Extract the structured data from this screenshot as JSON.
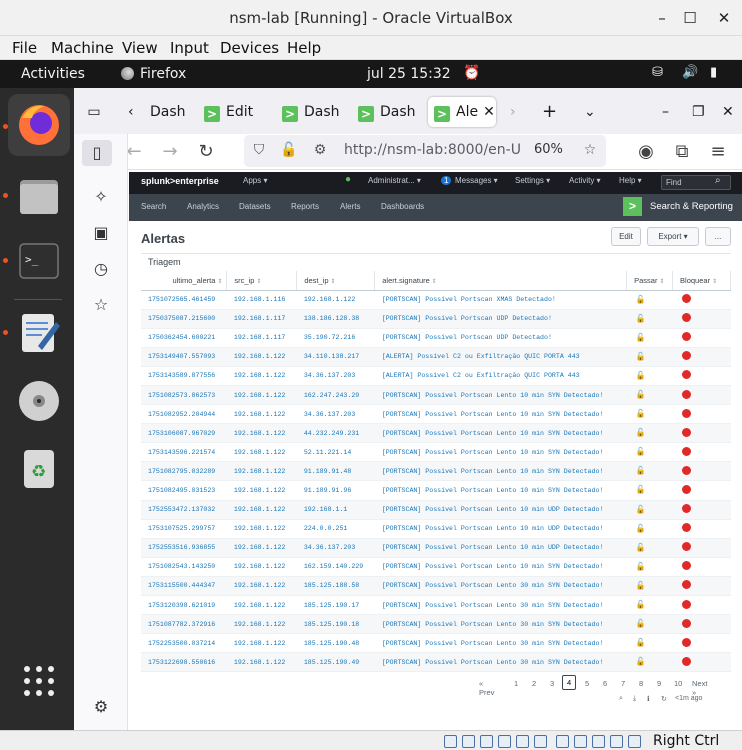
{
  "window": {
    "title": "nsm-lab [Running] - Oracle VirtualBox",
    "min": "–",
    "max": "☐",
    "close": "✕"
  },
  "vbox_menu": [
    "File",
    "Machine",
    "View",
    "Input",
    "Devices",
    "Help"
  ],
  "gnome": {
    "activities": "Activities",
    "app": "Firefox",
    "clock": "jul 25  15:32"
  },
  "tabs": [
    {
      "label": "Dash",
      "icon": ">"
    },
    {
      "label": "Edit",
      "icon": ">"
    },
    {
      "label": "Dash",
      "icon": ">"
    },
    {
      "label": "Dash",
      "icon": ">"
    },
    {
      "label": "Ale",
      "icon": ">"
    }
  ],
  "browser": {
    "url": "http://nsm-lab:8000/en-U",
    "zoom": "60%"
  },
  "splunk": {
    "logo": "splunk>enterprise",
    "top_menu": [
      "Apps ▾",
      "Administrat... ▾",
      "Messages ▾",
      "Settings ▾",
      "Activity ▾",
      "Help ▾"
    ],
    "messages_count": "1",
    "find_placeholder": "Find",
    "app_nav": [
      "Search",
      "Analytics",
      "Datasets",
      "Reports",
      "Alerts",
      "Dashboards"
    ],
    "app_name": "Search & Reporting",
    "page_title": "Alertas",
    "edit_label": "Edit",
    "export_label": "Export ▾",
    "more_label": "...",
    "panel_title": "Triagem",
    "columns": [
      "ultimo_alerta",
      "src_ip",
      "dest_ip",
      "alert.signature",
      "Passar",
      "Bloquear"
    ],
    "rows": [
      [
        "1751072565.461459",
        "192.168.1.116",
        "192.168.1.122",
        "[PORTSCAN] Possível Portscan XMAS Detectado!"
      ],
      [
        "1750375087.215600",
        "192.168.1.117",
        "138.186.128.38",
        "[PORTSCAN] Possível Portscan UDP Detectado!"
      ],
      [
        "1750362454.600221",
        "192.168.1.117",
        "35.190.72.216",
        "[PORTSCAN] Possível Portscan UDP Detectado!"
      ],
      [
        "1753149407.557093",
        "192.168.1.122",
        "34.110.138.217",
        "[ALERTA] Possível C2 ou Exfiltração QUIC PORTA 443"
      ],
      [
        "1753143589.877556",
        "192.168.1.122",
        "34.36.137.203",
        "[ALERTA] Possível C2 ou Exfiltração QUIC PORTA 443"
      ],
      [
        "1751082573.862573",
        "192.168.1.122",
        "162.247.243.29",
        "[PORTSCAN] Possível Portscan Lento 10 min SYN Detectado!"
      ],
      [
        "1751082952.204944",
        "192.168.1.122",
        "34.36.137.203",
        "[PORTSCAN] Possível Portscan Lento 10 min SYN Detectado!"
      ],
      [
        "1753106087.967029",
        "192.168.1.122",
        "44.232.249.231",
        "[PORTSCAN] Possível Portscan Lento 10 min SYN Detectado!"
      ],
      [
        "1753143596.221574",
        "192.168.1.122",
        "52.11.221.14",
        "[PORTSCAN] Possível Portscan Lento 10 min SYN Detectado!"
      ],
      [
        "1751082795.032289",
        "192.168.1.122",
        "91.189.91.48",
        "[PORTSCAN] Possível Portscan Lento 10 min SYN Detectado!"
      ],
      [
        "1751082495.031523",
        "192.168.1.122",
        "91.189.91.96",
        "[PORTSCAN] Possível Portscan Lento 10 min SYN Detectado!"
      ],
      [
        "1752553472.137032",
        "192.168.1.122",
        "192.168.1.1",
        "[PORTSCAN] Possível Portscan Lento 10 min UDP Detectado!"
      ],
      [
        "1753107525.299757",
        "192.168.1.122",
        "224.0.0.251",
        "[PORTSCAN] Possível Portscan Lento 10 min UDP Detectado!"
      ],
      [
        "1752553516.936855",
        "192.168.1.122",
        "34.36.137.203",
        "[PORTSCAN] Possível Portscan Lento 10 min UDP Detectado!"
      ],
      [
        "1751082543.143250",
        "192.168.1.122",
        "162.159.140.229",
        "[PORTSCAN] Possível Portscan Lento 10 min SYN Detectado!"
      ],
      [
        "1753115500.444347",
        "192.168.1.122",
        "185.125.188.58",
        "[PORTSCAN] Possível Portscan Lento 30 min SYN Detectado!"
      ],
      [
        "1753120398.621019",
        "192.168.1.122",
        "185.125.190.17",
        "[PORTSCAN] Possível Portscan Lento 30 min SYN Detectado!"
      ],
      [
        "1751087782.372916",
        "192.168.1.122",
        "185.125.190.18",
        "[PORTSCAN] Possível Portscan Lento 30 min SYN Detectado!"
      ],
      [
        "1752253500.037214",
        "192.168.1.122",
        "185.125.190.48",
        "[PORTSCAN] Possível Portscan Lento 30 min SYN Detectado!"
      ],
      [
        "1753122698.550616",
        "192.168.1.122",
        "185.125.190.49",
        "[PORTSCAN] Possível Portscan Lento 30 min SYN Detectado!"
      ]
    ],
    "pager": {
      "prev": "« Prev",
      "pages": [
        "1",
        "2",
        "3",
        "4",
        "5",
        "6",
        "7",
        "8",
        "9",
        "10"
      ],
      "current": "4",
      "next": "Next »"
    },
    "last_updated": "<1m ago"
  },
  "status": {
    "right_ctrl": "Right Ctrl"
  }
}
